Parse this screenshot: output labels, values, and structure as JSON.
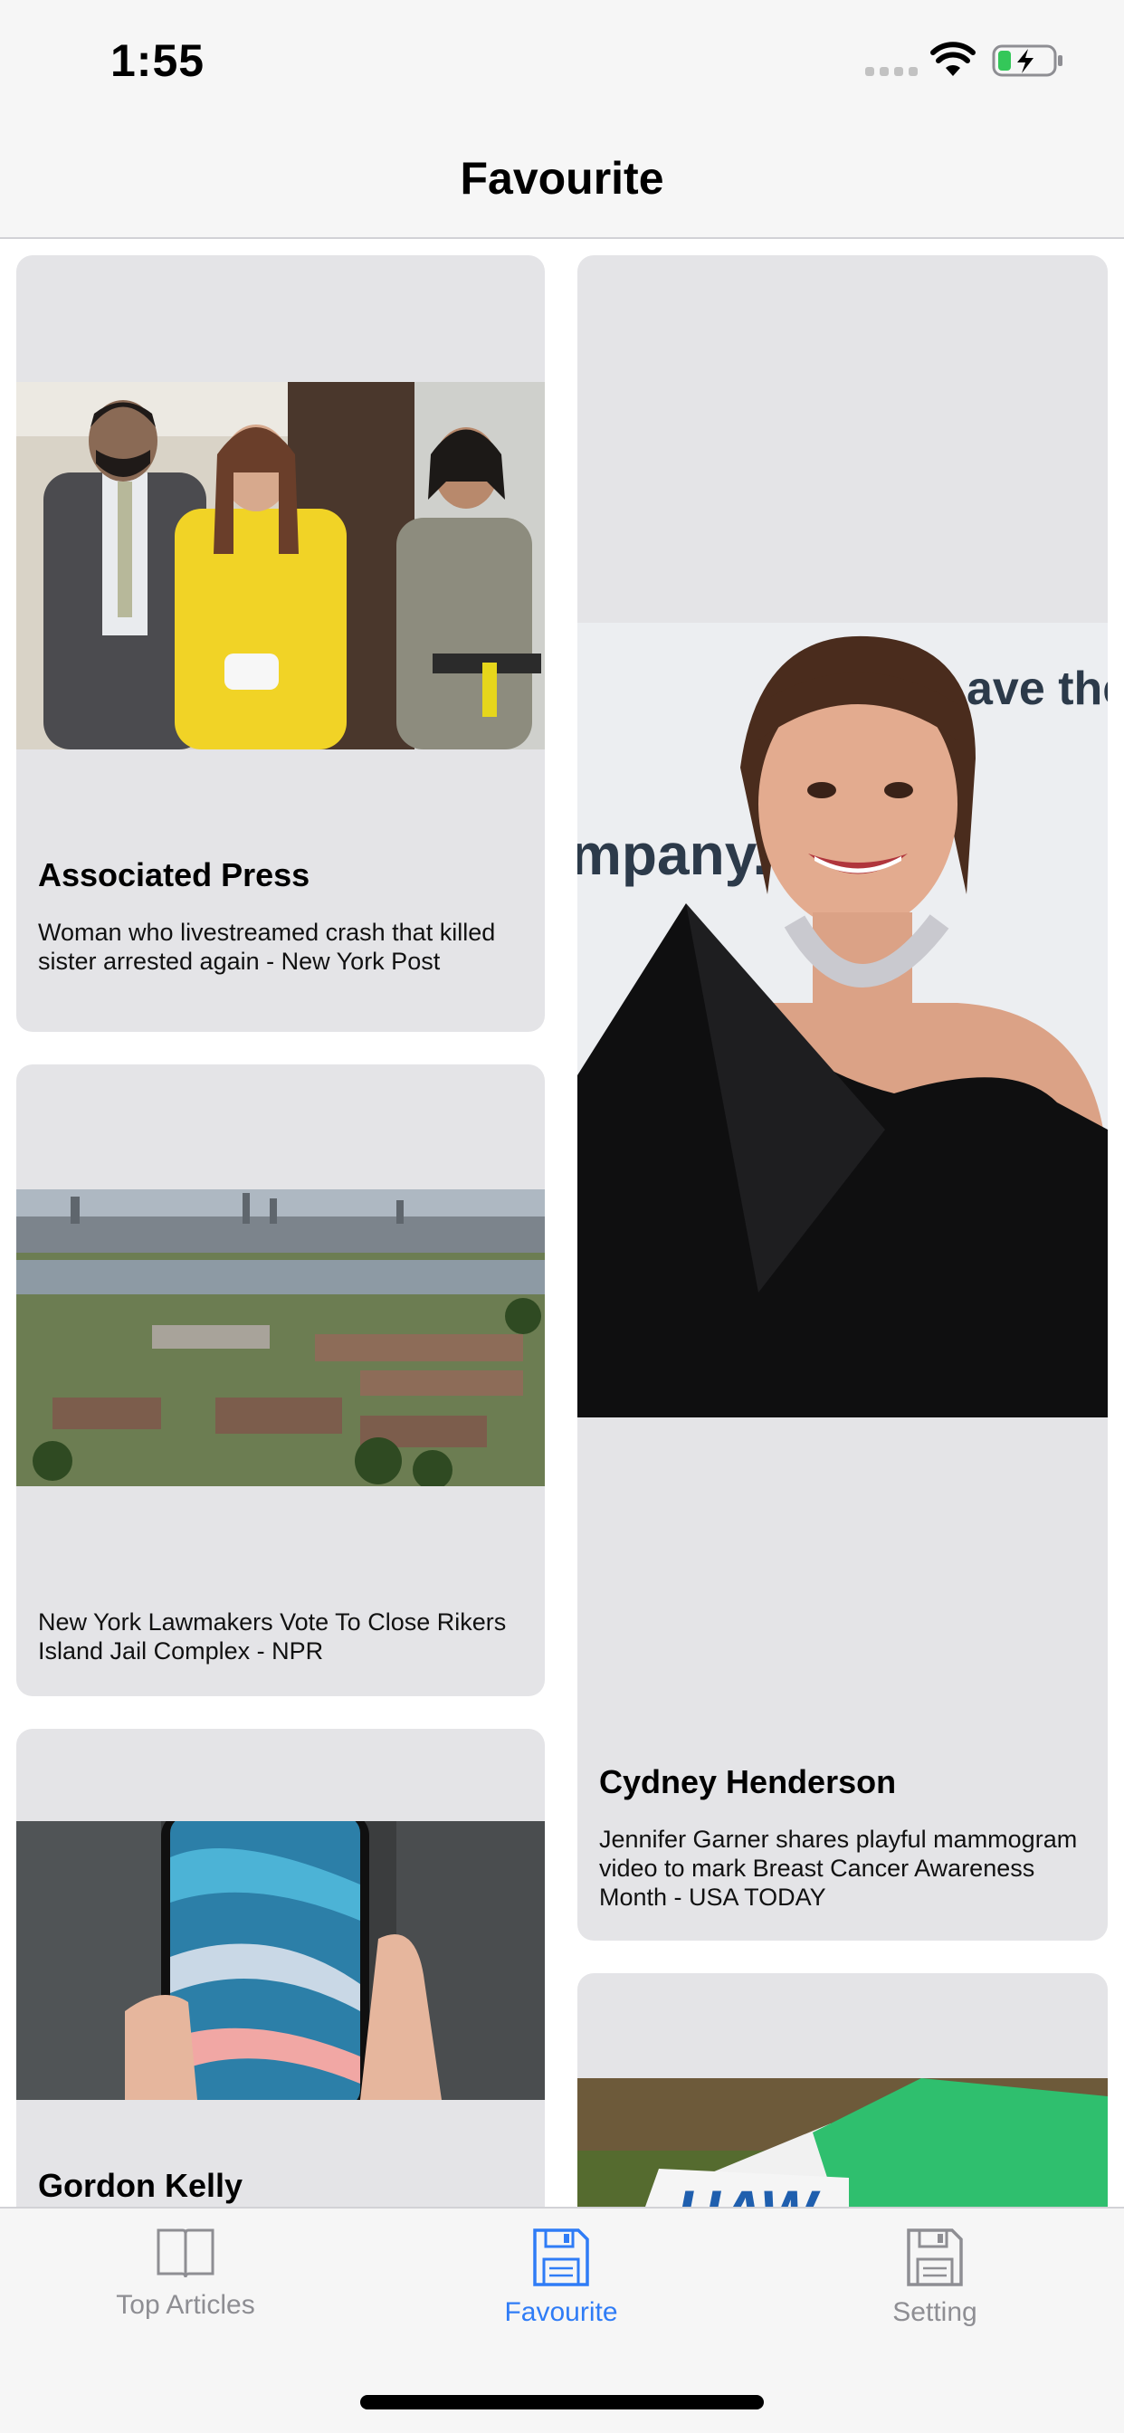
{
  "status_bar": {
    "time": "1:55"
  },
  "nav": {
    "title": "Favourite"
  },
  "articles": [
    {
      "author": "Associated Press",
      "title": "Woman who livestreamed crash that killed sister arrested again - New York Post",
      "image": "court-photo"
    },
    {
      "author": "Cydney Henderson",
      "title": "Jennifer Garner shares playful mammogram video to mark Breast Cancer Awareness Month - USA TODAY",
      "image": "portrait-photo",
      "image_text": "mpany.",
      "image_text2": "ave the"
    },
    {
      "author": "",
      "title": "New York Lawmakers Vote To Close Rikers Island Jail Complex - NPR",
      "image": "aerial-photo"
    },
    {
      "author": "Gordon Kelly",
      "title": "",
      "image": "phone-photo"
    },
    {
      "author": "",
      "title": "",
      "image": "protest-sign-photo",
      "image_text": "UAW"
    }
  ],
  "tabs": [
    {
      "label": "Top Articles",
      "icon": "book-icon",
      "active": false
    },
    {
      "label": "Favourite",
      "icon": "floppy-disk-icon",
      "active": true
    },
    {
      "label": "Setting",
      "icon": "floppy-disk-icon",
      "active": false
    }
  ],
  "colors": {
    "accent": "#2f7cf6",
    "card_bg": "#e4e4e7",
    "inactive_tab": "#8e8e93"
  }
}
